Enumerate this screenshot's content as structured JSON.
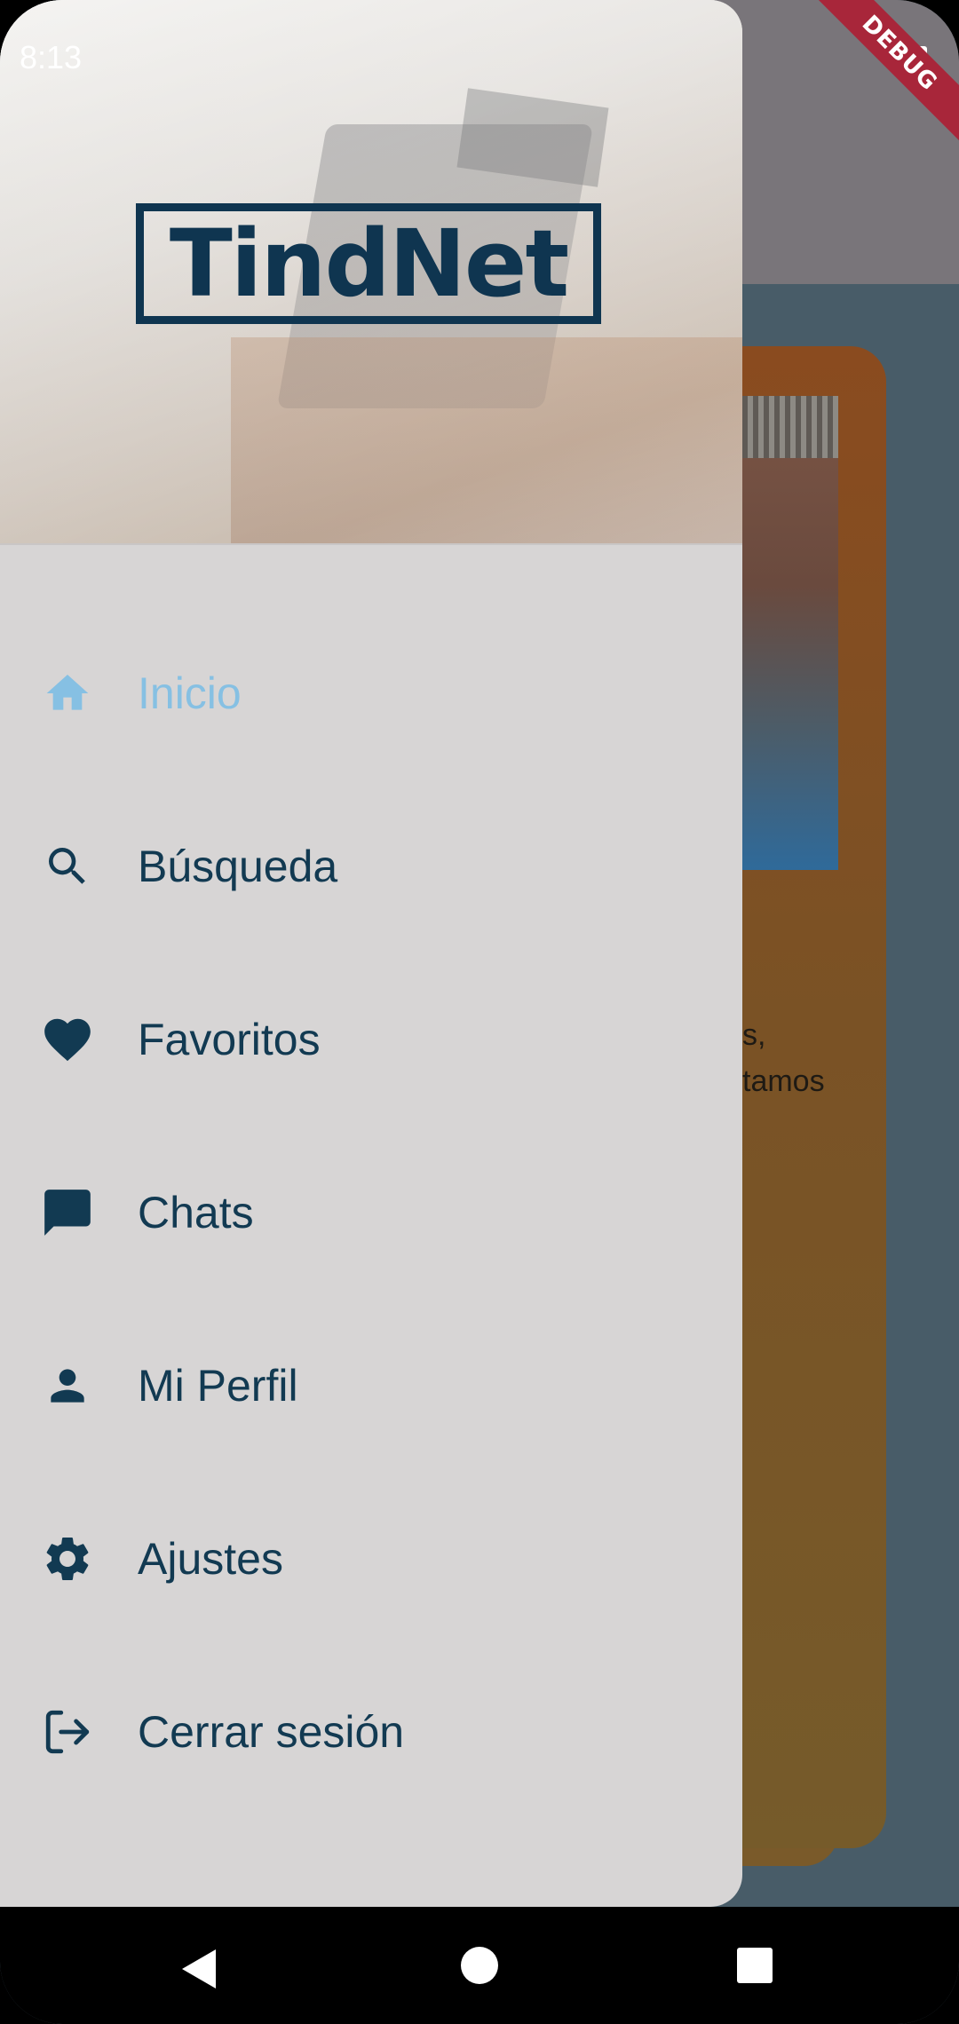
{
  "status_bar": {
    "time": "8:13"
  },
  "debug_banner": "DEBUG",
  "drawer": {
    "logo": "TindNet",
    "items": [
      {
        "label": "Inicio",
        "icon": "home-icon",
        "active": true
      },
      {
        "label": "Búsqueda",
        "icon": "search-icon",
        "active": false
      },
      {
        "label": "Favoritos",
        "icon": "heart-icon",
        "active": false
      },
      {
        "label": "Chats",
        "icon": "chat-icon",
        "active": false
      },
      {
        "label": "Mi Perfil",
        "icon": "person-icon",
        "active": false
      },
      {
        "label": "Ajustes",
        "icon": "gear-icon",
        "active": false
      },
      {
        "label": "Cerrar sesión",
        "icon": "logout-icon",
        "active": false
      }
    ]
  },
  "background_card": {
    "text_fragment": "s,\ntamos"
  },
  "colors": {
    "primary": "#123a52",
    "active": "#86c0e3",
    "drawer_bg": "#d7d5d5",
    "card": "#7a5225"
  }
}
